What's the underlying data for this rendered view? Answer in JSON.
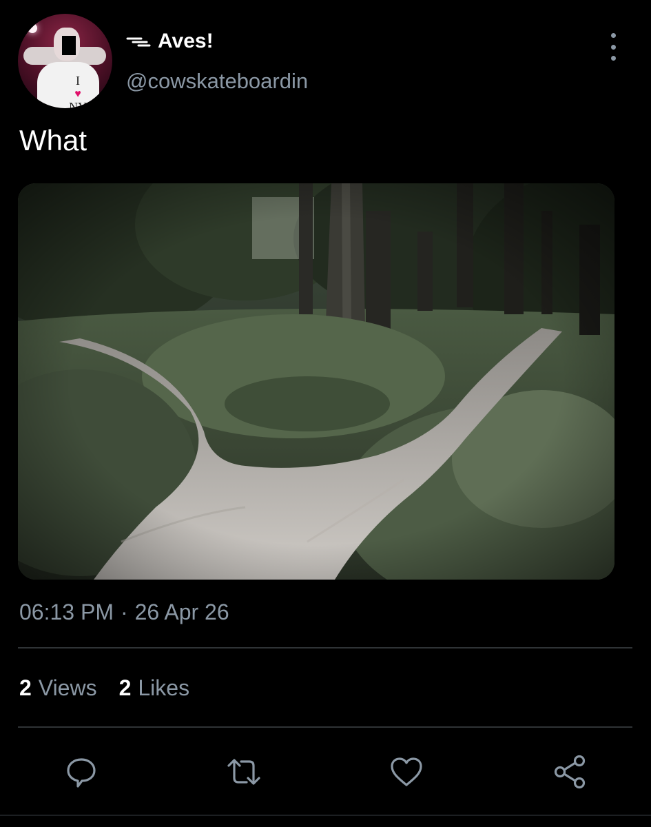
{
  "author": {
    "display_name": "Aves!",
    "handle": "@cowskateboardin",
    "name_icon": "winding-lines-icon",
    "avatar_text": "I ♥ NY"
  },
  "tweet": {
    "text": "What",
    "media": {
      "kind": "photo",
      "subject": "forest-trail-fork"
    },
    "time": "06:13 PM",
    "separator": "·",
    "date": "26 Apr 26"
  },
  "stats": {
    "views_count": "2",
    "views_label": "Views",
    "likes_count": "2",
    "likes_label": "Likes"
  },
  "actions": {
    "reply_icon": "reply-icon",
    "retweet_icon": "retweet-icon",
    "like_icon": "heart-icon",
    "share_icon": "share-icon"
  },
  "colors": {
    "background": "#000000",
    "text": "#ffffff",
    "muted": "#8b98a5",
    "divider": "#2f3336"
  }
}
